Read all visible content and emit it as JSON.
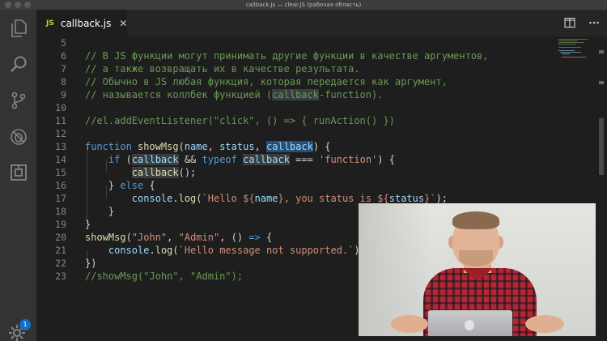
{
  "window": {
    "title": "callback.js — clear.JS (рабочая область)"
  },
  "activity_bar": {
    "items": [
      {
        "name": "explorer",
        "icon": "files-icon"
      },
      {
        "name": "search",
        "icon": "search-icon"
      },
      {
        "name": "source-control",
        "icon": "source-control-icon"
      },
      {
        "name": "debug",
        "icon": "debug-icon"
      },
      {
        "name": "extensions",
        "icon": "extensions-icon"
      }
    ],
    "settings": {
      "icon": "gear-icon",
      "badge": "1"
    }
  },
  "tab": {
    "lang_badge": "JS",
    "filename": "callback.js",
    "close": "✕"
  },
  "tab_actions": {
    "split": "split-editor-icon",
    "more": "more-actions-icon"
  },
  "editor": {
    "lines": [
      {
        "n": "5",
        "tokens": []
      },
      {
        "n": "6",
        "tokens": [
          {
            "t": "// В JS функции могут принимать другие функции в качестве аргументов,",
            "c": "comment"
          }
        ]
      },
      {
        "n": "7",
        "tokens": [
          {
            "t": "// а также возвращать их в качестве результата.",
            "c": "comment"
          }
        ]
      },
      {
        "n": "8",
        "tokens": [
          {
            "t": "// Обычно в JS любая функция, которая передается как аргумент,",
            "c": "comment"
          }
        ]
      },
      {
        "n": "9",
        "tokens": [
          {
            "t": "// называется коллбек функцией (",
            "c": "comment"
          },
          {
            "t": "callback",
            "c": "comment",
            "h": "hl"
          },
          {
            "t": "-function).",
            "c": "comment"
          }
        ]
      },
      {
        "n": "10",
        "tokens": []
      },
      {
        "n": "11",
        "tokens": [
          {
            "t": "//el.addEventListener(\"click\", () => { runAction() })",
            "c": "comment"
          }
        ]
      },
      {
        "n": "12",
        "tokens": []
      },
      {
        "n": "13",
        "tokens": [
          {
            "t": "function ",
            "c": "keyword"
          },
          {
            "t": "showMsg",
            "c": "func"
          },
          {
            "t": "(",
            "c": "plain"
          },
          {
            "t": "name",
            "c": "param"
          },
          {
            "t": ", ",
            "c": "plain"
          },
          {
            "t": "status",
            "c": "param"
          },
          {
            "t": ", ",
            "c": "plain"
          },
          {
            "t": "callback",
            "c": "param",
            "h": "hl-sel"
          },
          {
            "t": ") {",
            "c": "plain"
          }
        ]
      },
      {
        "n": "14",
        "tokens": [
          {
            "t": "    ",
            "c": "plain"
          },
          {
            "t": "if",
            "c": "keyword"
          },
          {
            "t": " (",
            "c": "plain"
          },
          {
            "t": "callback",
            "c": "param",
            "h": "hl"
          },
          {
            "t": " && ",
            "c": "plain"
          },
          {
            "t": "typeof",
            "c": "keyword"
          },
          {
            "t": " ",
            "c": "plain"
          },
          {
            "t": "callback",
            "c": "param",
            "h": "hl"
          },
          {
            "t": " === ",
            "c": "plain"
          },
          {
            "t": "'function'",
            "c": "string"
          },
          {
            "t": ") {",
            "c": "plain"
          }
        ]
      },
      {
        "n": "15",
        "tokens": [
          {
            "t": "        ",
            "c": "plain"
          },
          {
            "t": "callback",
            "c": "func",
            "h": "hl"
          },
          {
            "t": "();",
            "c": "plain"
          }
        ]
      },
      {
        "n": "16",
        "tokens": [
          {
            "t": "    } ",
            "c": "plain"
          },
          {
            "t": "else",
            "c": "keyword"
          },
          {
            "t": " {",
            "c": "plain"
          }
        ]
      },
      {
        "n": "17",
        "tokens": [
          {
            "t": "        ",
            "c": "plain"
          },
          {
            "t": "console",
            "c": "param"
          },
          {
            "t": ".",
            "c": "plain"
          },
          {
            "t": "log",
            "c": "func"
          },
          {
            "t": "(",
            "c": "plain"
          },
          {
            "t": "`Hello ${",
            "c": "string"
          },
          {
            "t": "name",
            "c": "param"
          },
          {
            "t": "}, you status is ${",
            "c": "string"
          },
          {
            "t": "status",
            "c": "param"
          },
          {
            "t": "}`",
            "c": "string"
          },
          {
            "t": ");",
            "c": "plain"
          }
        ]
      },
      {
        "n": "18",
        "tokens": [
          {
            "t": "    }",
            "c": "plain"
          }
        ]
      },
      {
        "n": "19",
        "tokens": [
          {
            "t": "}",
            "c": "plain"
          }
        ]
      },
      {
        "n": "20",
        "tokens": [
          {
            "t": "showMsg",
            "c": "func"
          },
          {
            "t": "(",
            "c": "plain"
          },
          {
            "t": "\"John\"",
            "c": "string"
          },
          {
            "t": ", ",
            "c": "plain"
          },
          {
            "t": "\"Admin\"",
            "c": "string"
          },
          {
            "t": ", () ",
            "c": "plain"
          },
          {
            "t": "=>",
            "c": "keyword"
          },
          {
            "t": " {",
            "c": "plain"
          }
        ]
      },
      {
        "n": "21",
        "tokens": [
          {
            "t": "    ",
            "c": "plain"
          },
          {
            "t": "console",
            "c": "param"
          },
          {
            "t": ".",
            "c": "plain"
          },
          {
            "t": "log",
            "c": "func"
          },
          {
            "t": "(",
            "c": "plain"
          },
          {
            "t": "`Hello message not supported.`",
            "c": "string"
          },
          {
            "t": ")",
            "c": "plain"
          }
        ]
      },
      {
        "n": "22",
        "tokens": [
          {
            "t": "})",
            "c": "plain"
          }
        ]
      },
      {
        "n": "23",
        "tokens": [
          {
            "t": "//showMsg(\"John\", \"Admin\");",
            "c": "comment"
          }
        ]
      }
    ]
  },
  "colors": {
    "comment": "#6a9955",
    "keyword": "#569cd6",
    "function": "#dcdcaa",
    "parameter": "#9cdcfe",
    "string": "#ce9178",
    "editor_bg": "#1e1e1e",
    "activity_bar_bg": "#333333"
  }
}
